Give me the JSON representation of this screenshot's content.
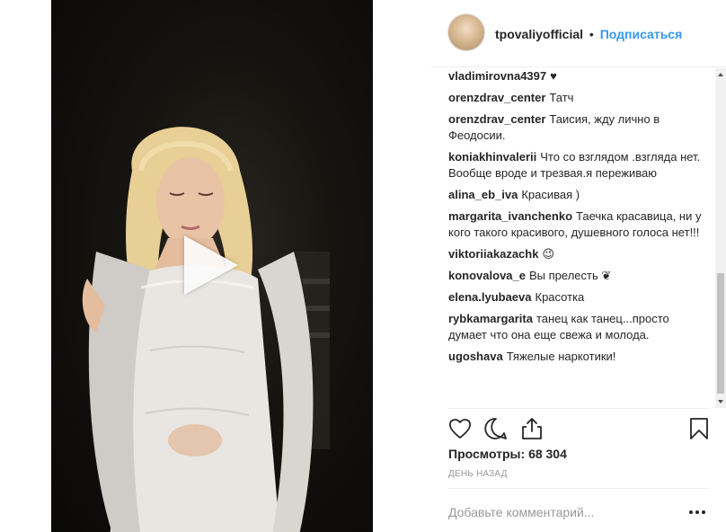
{
  "header": {
    "username": "tpovaliyofficial",
    "separator": "•",
    "follow_label": "Подписаться"
  },
  "comments": [
    {
      "user": "vladimirovna4397",
      "text": "♥"
    },
    {
      "user": "orenzdrav_center",
      "text": "Татч"
    },
    {
      "user": "orenzdrav_center",
      "text": "Таисия, жду лично в Феодосии."
    },
    {
      "user": "koniakhinvalerii",
      "text": "Что со взглядом .взгляда нет. Вообще вроде и трезвая.я переживаю"
    },
    {
      "user": "alina_eb_iva",
      "text": "Красивая )"
    },
    {
      "user": "margarita_ivanchenko",
      "text": "Таечка красавица, ни у кого такого красивого, душевного голоса нет!!!"
    },
    {
      "user": "viktoriiakazachk",
      "text": "😉"
    },
    {
      "user": "konovalova_e",
      "text": "Вы прелесть ❦"
    },
    {
      "user": "elena.lyubaeva",
      "text": "Красотка"
    },
    {
      "user": "rybkamargarita",
      "text": "танец как танец...просто думает что она еще свежа и молода."
    },
    {
      "user": "ugoshava",
      "text": "Тяжелые наркотики!"
    }
  ],
  "actions": {
    "like_icon": "heart-icon",
    "comment_icon": "comment-icon",
    "share_icon": "share-icon",
    "save_icon": "bookmark-icon"
  },
  "stats": {
    "views_label": "Просмотры:",
    "views_count": "68 304",
    "date": "ДЕНЬ НАЗАД"
  },
  "add_comment": {
    "placeholder": "Добавьте комментарий..."
  },
  "colors": {
    "accent": "#3897f0",
    "text": "#262626",
    "muted": "#999999",
    "border": "#efefef"
  }
}
